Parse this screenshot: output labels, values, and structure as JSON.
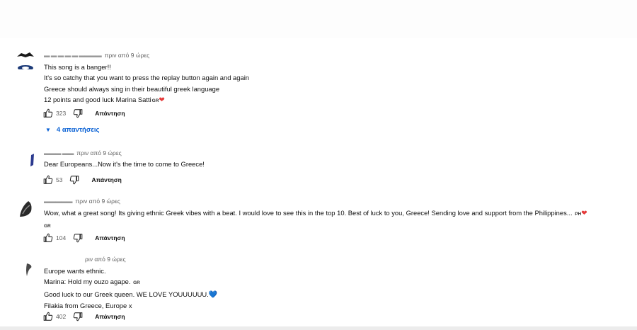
{
  "comments": [
    {
      "author": "▬ ▬ ▬ ▬ ▬ ▬▬▬▬",
      "time": "πριν από 9 ώρες",
      "lines": [
        "This song is a banger!!",
        "It's so catchy that you want to press the replay button again and again",
        "Greece should always sing in their beautiful greek language",
        "12 points and good luck Marina Satti"
      ],
      "flag": "GR",
      "likes": "323",
      "reply_label": "Απάντηση",
      "replies_label": "4 απαντήσεις"
    },
    {
      "author": "▬▬▬ ▬▬",
      "time": "πριν από 9 ώρες",
      "lines": [
        "Dear Europeans...Now it's the time to come to Greece!"
      ],
      "likes": "53",
      "reply_label": "Απάντηση"
    },
    {
      "author": "▬▬▬▬▬",
      "time": "πριν από 9 ώρες",
      "lines": [
        "Wow, what a great song! Its giving ethnic Greek vibes with a beat. I would love to see this in the top 10. Best of luck to you, Greece! Sending love and support from the Philippines..."
      ],
      "flag_inline": "PH",
      "flag_line2": "GR",
      "likes": "104",
      "reply_label": "Απάντηση"
    },
    {
      "author": "",
      "time": "ριν από 9 ώρες",
      "lines": [
        "Europe wants ethnic.",
        "Marina: Hold my ouzo agape.",
        "Good luck to our Greek queen. WE LOVE YOUUUUUU.",
        "Filakia from Greece, Europe x"
      ],
      "flag": "GR",
      "likes": "402",
      "reply_label": "Απάντηση"
    }
  ],
  "icons": {
    "like": "thumbs-up-icon",
    "dislike": "thumbs-down-icon",
    "reply_toggle": "caret-down-icon"
  },
  "colors": {
    "link": "#065fd4",
    "heart": "#e53b3b",
    "blue_heart": "#2d8ae0"
  }
}
